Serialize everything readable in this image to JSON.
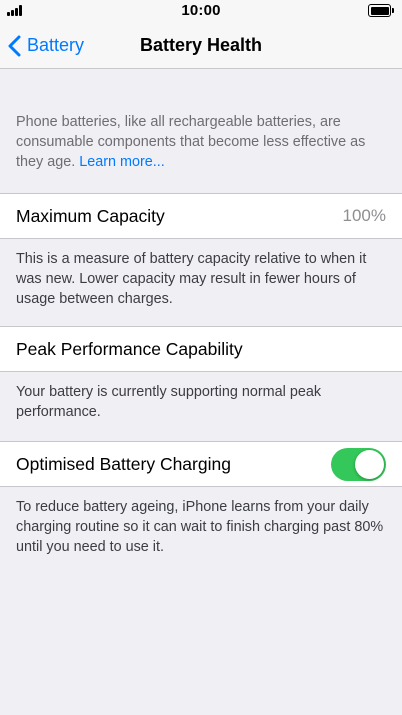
{
  "status_bar": {
    "time": "10:00"
  },
  "nav": {
    "back_label": "Battery",
    "title": "Battery Health"
  },
  "intro": {
    "text": "Phone batteries, like all rechargeable batteries, are consumable components that become less effective as they age.",
    "link": "Learn more..."
  },
  "maximum_capacity": {
    "label": "Maximum Capacity",
    "value": "100%",
    "footer": "This is a measure of battery capacity relative to when it was new. Lower capacity may result in fewer hours of usage between charges."
  },
  "peak_performance": {
    "label": "Peak Performance Capability",
    "footer": "Your battery is currently supporting normal peak performance."
  },
  "optimised_charging": {
    "label": "Optimised Battery Charging",
    "enabled": true,
    "footer": "To reduce battery ageing, iPhone learns from your daily charging routine so it can wait to finish charging past 80% until you need to use it."
  },
  "colors": {
    "accent": "#007aff",
    "toggle_on": "#34c759",
    "background": "#efeff4"
  }
}
